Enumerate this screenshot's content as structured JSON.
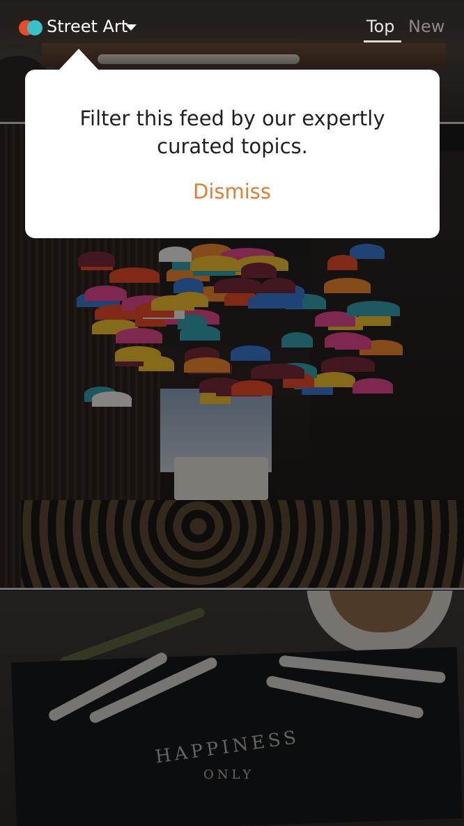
{
  "header": {
    "feed_title": "Street Art",
    "tabs": [
      {
        "label": "Top",
        "selected": true
      },
      {
        "label": "New",
        "selected": false
      }
    ],
    "logo_colors": [
      "#e94b2a",
      "#37c2c9"
    ]
  },
  "tooltip": {
    "message": "Filter this feed by our expertly curated topics.",
    "dismiss_label": "Dismiss",
    "accent_color": "#e07e35"
  },
  "feed": {
    "photos": [
      {
        "subject": "desk with pencils"
      },
      {
        "subject": "umbrella-covered alley"
      },
      {
        "subject": "desk with pens and coffee",
        "visible_text": [
          "HAPPINESS",
          "ONLY"
        ]
      }
    ]
  }
}
